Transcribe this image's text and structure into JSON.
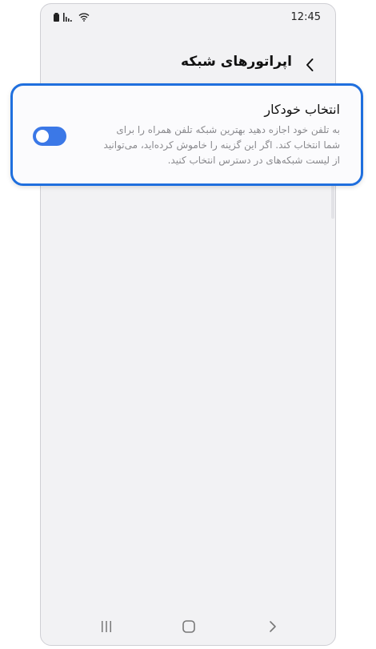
{
  "status_bar": {
    "time": "12:45",
    "icons": [
      "battery-icon",
      "signal-icon",
      "wifi-icon"
    ]
  },
  "header": {
    "title": "اپراتورهای شبکه",
    "back_icon": "chevron-left-icon"
  },
  "setting": {
    "title": "انتخاب خودکار",
    "description": "به تلفن خود اجازه دهید بهترین شبکه تلفن همراه را برای شما انتخاب کند. اگر این گزینه را خاموش کرده‌اید، می‌توانید از لیست شبکه‌های در دسترس انتخاب کنید.",
    "toggle_on": true
  },
  "nav_bar": {
    "icons": [
      "recents-icon",
      "home-icon",
      "back-icon"
    ]
  },
  "colors": {
    "accent": "#3b78e7",
    "highlight_border": "#1f6fde",
    "screen_background": "#f2f2f4",
    "description_text": "#8a8a8e"
  }
}
